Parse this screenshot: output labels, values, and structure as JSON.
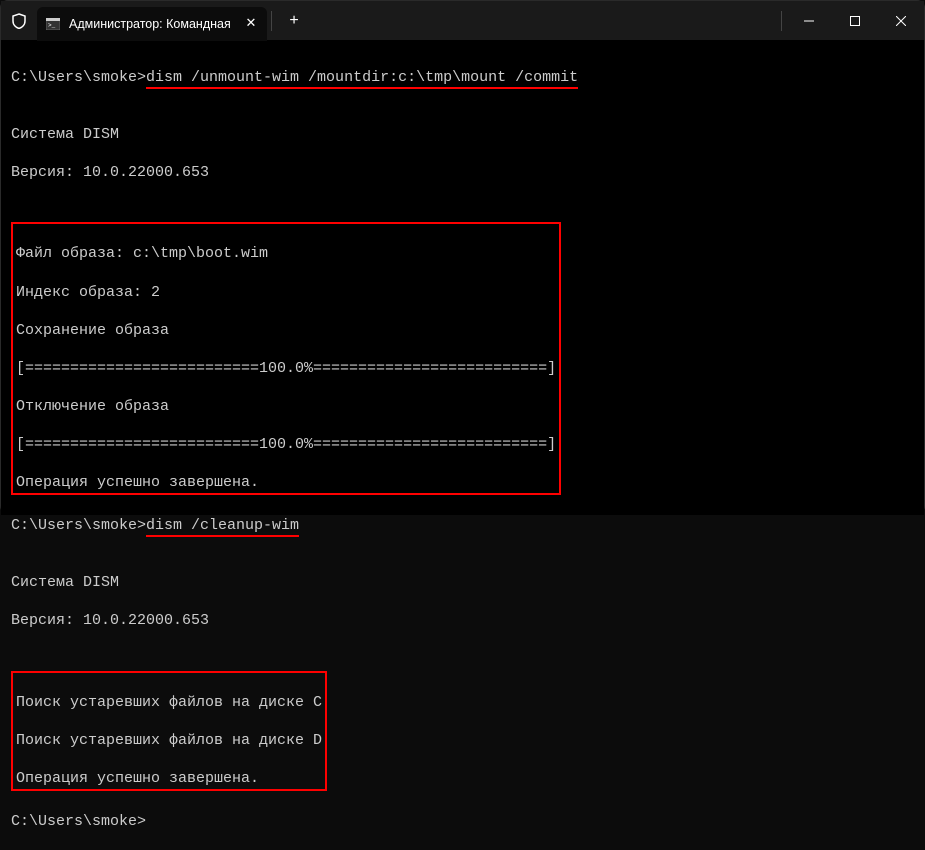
{
  "tab": {
    "title": "Администратор: Командная"
  },
  "terminal": {
    "prompt1": "C:\\Users\\smoke>",
    "cmd1": "dism /unmount-wim /mountdir:c:\\tmp\\mount /commit",
    "blank": "",
    "sys_dism": "Cистема DISM",
    "version": "Версия: 10.0.22000.653",
    "box1": {
      "l1": "Файл образа: c:\\tmp\\boot.wim",
      "l2": "Индекс образа: 2",
      "l3": "Сохранение образа",
      "l4": "[==========================100.0%==========================]",
      "l5": "Отключение образа",
      "l6": "[==========================100.0%==========================]",
      "l7": "Операция успешно завершена."
    },
    "prompt2": "C:\\Users\\smoke>",
    "cmd2": "dism /cleanup-wim",
    "box2": {
      "l1": "Поиск устаревших файлов на диске C",
      "l2": "Поиск устаревших файлов на диске D",
      "l3": "Операция успешно завершена."
    },
    "prompt3": "C:\\Users\\smoke>"
  }
}
